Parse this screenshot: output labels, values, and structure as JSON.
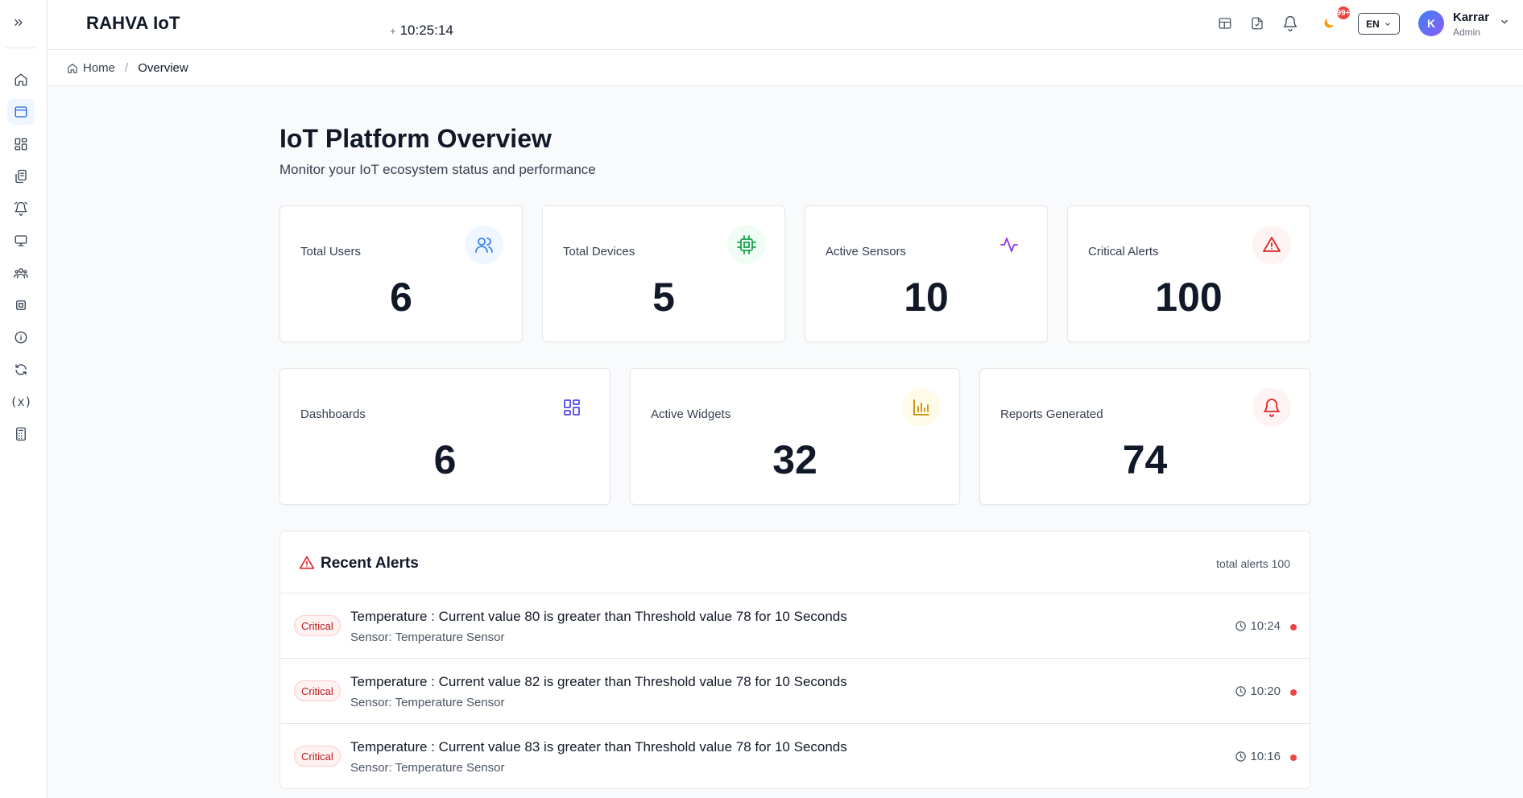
{
  "app": {
    "brand": "RAHVA IoT",
    "clock": "10:25:14",
    "clock_prefix": "+"
  },
  "sidebar": {
    "items": [
      {
        "name": "home-icon",
        "active": false
      },
      {
        "name": "overview-icon",
        "active": true
      },
      {
        "name": "dashboards-icon",
        "active": false
      },
      {
        "name": "reports-icon",
        "active": false
      },
      {
        "name": "alarms-icon",
        "active": false
      },
      {
        "name": "monitor-icon",
        "active": false
      },
      {
        "name": "users-icon",
        "active": false
      },
      {
        "name": "chip-icon",
        "active": false
      },
      {
        "name": "info-icon",
        "active": false
      },
      {
        "name": "refresh-icon",
        "active": false
      },
      {
        "name": "variables-icon",
        "active": false
      },
      {
        "name": "calculator-icon",
        "active": false
      }
    ]
  },
  "header": {
    "notif_count": "99+",
    "language": "EN",
    "user": {
      "initial": "K",
      "name": "Karrar",
      "role": "Admin"
    }
  },
  "breadcrumb": {
    "home": "Home",
    "current": "Overview"
  },
  "page": {
    "title": "IoT Platform Overview",
    "subtitle": "Monitor your IoT ecosystem status and performance"
  },
  "stats_row1": [
    {
      "label": "Total Users",
      "value": "6",
      "icon": "users-icon",
      "icon_color": "#3b82f6",
      "icon_bg": "#eff6ff"
    },
    {
      "label": "Total Devices",
      "value": "5",
      "icon": "chip-icon",
      "icon_color": "#16a34a",
      "icon_bg": "#f0fdf4"
    },
    {
      "label": "Active Sensors",
      "value": "10",
      "icon": "activity-icon",
      "icon_color": "#9333ea",
      "icon_bg": "#ffffff"
    },
    {
      "label": "Critical Alerts",
      "value": "100",
      "icon": "warning-icon",
      "icon_color": "#dc2626",
      "icon_bg": "#fef2f2"
    }
  ],
  "stats_row2": [
    {
      "label": "Dashboards",
      "value": "6",
      "icon": "grid-icon",
      "icon_color": "#4f46e5",
      "icon_bg": "#ffffff"
    },
    {
      "label": "Active Widgets",
      "value": "32",
      "icon": "bar-chart-icon",
      "icon_color": "#ca8a04",
      "icon_bg": "#fefce8"
    },
    {
      "label": "Reports Generated",
      "value": "74",
      "icon": "bell-icon",
      "icon_color": "#dc2626",
      "icon_bg": "#fef2f2"
    }
  ],
  "alerts": {
    "title": "Recent Alerts",
    "total": "total alerts 100",
    "items": [
      {
        "severity": "Critical",
        "message": "Temperature : Current value 80 is greater than Threshold value 78 for 10 Seconds",
        "source": "Sensor: Temperature Sensor",
        "time": "10:24"
      },
      {
        "severity": "Critical",
        "message": "Temperature : Current value 82 is greater than Threshold value 78 for 10 Seconds",
        "source": "Sensor: Temperature Sensor",
        "time": "10:20"
      },
      {
        "severity": "Critical",
        "message": "Temperature : Current value 83 is greater than Threshold value 78 for 10 Seconds",
        "source": "Sensor: Temperature Sensor",
        "time": "10:16"
      }
    ]
  }
}
